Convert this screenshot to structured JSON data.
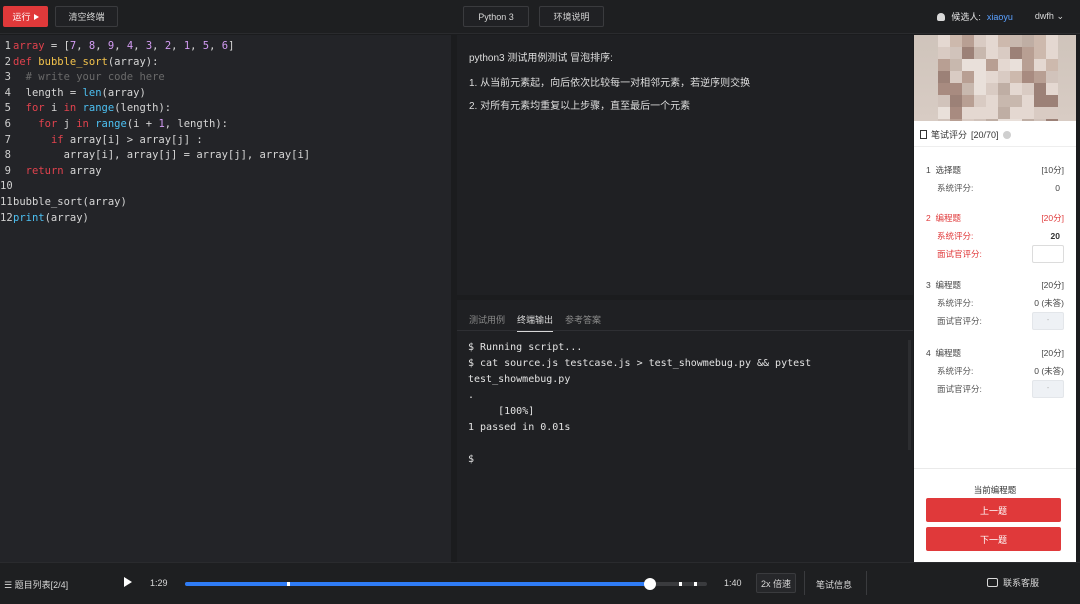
{
  "toolbar": {
    "run_label": "运行",
    "clear_label": "清空终端",
    "language_label": "Python 3",
    "env_label": "环境说明"
  },
  "user": {
    "candidate_label": "候选人:",
    "candidate_name": "xiaoyu",
    "account": "dwfh"
  },
  "editor": {
    "line_numbers": [
      "1",
      "2",
      "3",
      "4",
      "5",
      "6",
      "7",
      "8",
      "9",
      "10",
      "11",
      "12"
    ]
  },
  "question": {
    "title": "python3 测试用例测试 冒泡排序:",
    "steps": [
      "1. 从当前元素起，向后依次比较每一对相邻元素，若逆序则交换",
      "2. 对所有元素均重复以上步骤，直至最后一个元素"
    ]
  },
  "output": {
    "tabs": [
      "测试用例",
      "终端输出",
      "参考答案"
    ],
    "active_tab": "终端输出",
    "terminal": "$ Running script...\n$ cat source.js testcase.js > test_showmebug.py && pytest test_showmebug.py\n.\n     [100%]\n1 passed in 0.01s\n\n$"
  },
  "scoring": {
    "header": "笔试评分",
    "total": "[20/70]",
    "items": [
      {
        "num": "1",
        "type": "选择题",
        "points": "[10分]",
        "sys_label": "系统评分:",
        "sys_value": "0",
        "interviewer_label": null,
        "active": false
      },
      {
        "num": "2",
        "type": "编程题",
        "points": "[20分]",
        "sys_label": "系统评分:",
        "sys_value": "20",
        "interviewer_label": "面试官评分:",
        "active": true
      },
      {
        "num": "3",
        "type": "编程题",
        "points": "[20分]",
        "sys_label": "系统评分:",
        "sys_value": "0 (未答)",
        "interviewer_label": "面试官评分:",
        "active": false
      },
      {
        "num": "4",
        "type": "编程题",
        "points": "[20分]",
        "sys_label": "系统评分:",
        "sys_value": "0 (未答)",
        "interviewer_label": "面试官评分:",
        "active": false
      }
    ],
    "disabled_input": "-",
    "current_label": "当前编程题",
    "prev_label": "上一题",
    "next_label": "下一题"
  },
  "player": {
    "list_label": "题目列表[2/4]",
    "current_time": "1:29",
    "total_time": "1:40",
    "progress": 0.89,
    "speed": "2x 倍速",
    "info_label": "笔试信息",
    "support_label": "联系客服"
  },
  "colors": {
    "accent_red": "#e0393a",
    "accent_blue": "#2f7cf6"
  }
}
